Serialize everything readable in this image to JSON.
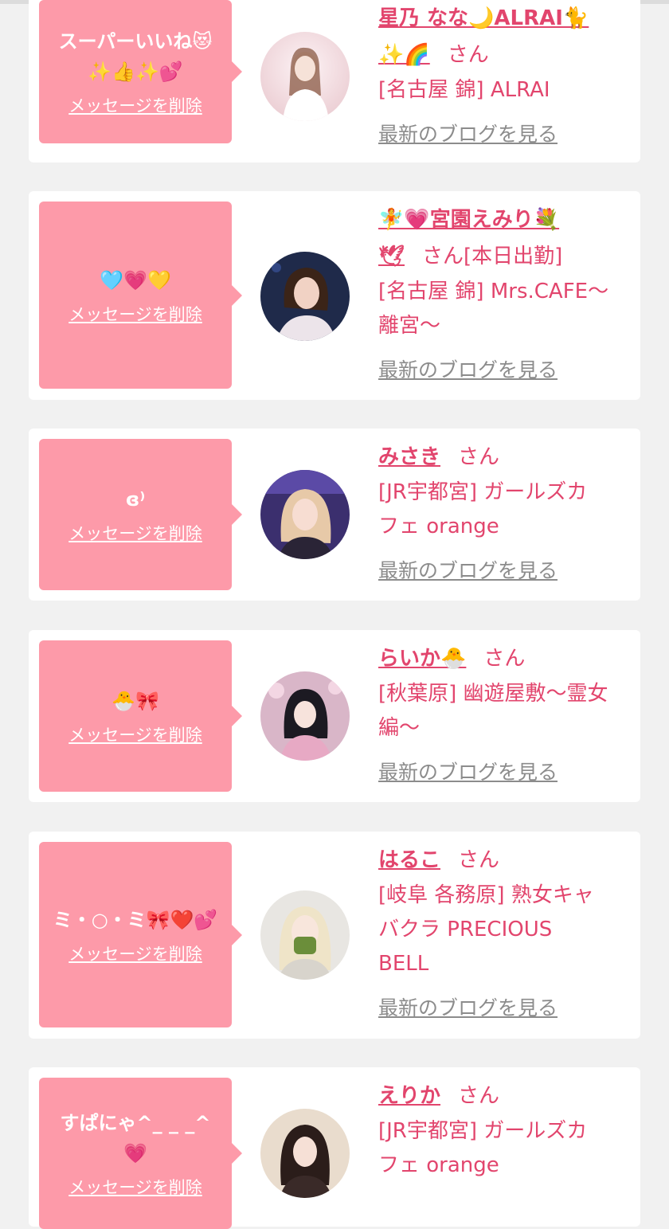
{
  "delete_label": "メッセージを削除",
  "blog_label": "最新のブログを見る",
  "colors": {
    "accent": "#e2456d",
    "bubble": "#fd9aa9",
    "card": "#ffffff",
    "background": "#f1f1f1",
    "link_gray": "#8c8c8c"
  },
  "items": [
    {
      "message": "スーパーいいね😻\n✨👍✨💕",
      "name": "星乃 なな🌙ALRAI🐈\n✨🌈",
      "san": "さん",
      "extra": "",
      "shop": "[名古屋 錦] ALRAI"
    },
    {
      "message": "🩵💗💛",
      "name": "🧚💗宮園えみり💐\n🕊",
      "san": "さん",
      "extra": "[本日出勤]",
      "shop": "[名古屋 錦] Mrs.CAFE〜\n離宮〜"
    },
    {
      "message": "ɞ⁾",
      "name": "みさき",
      "san": "さん",
      "extra": "",
      "shop": "[JR宇都宮] ガールズカ\nフェ orange"
    },
    {
      "message": "🐣🎀",
      "name": "らいか🐣",
      "san": "さん",
      "extra": "",
      "shop": "[秋葉原] 幽遊屋敷〜霊女\n編〜"
    },
    {
      "message": "ミ・○・ミ🎀❤️💕",
      "name": "はるこ",
      "san": "さん",
      "extra": "",
      "shop": "[岐阜 各務原]  熟女キャ\nバクラ PRECIOUS\nBELL"
    },
    {
      "message": "すぱにゃ^_ _ _^\n💗",
      "name": "えりか",
      "san": "さん",
      "extra": "",
      "shop": "[JR宇都宮] ガールズカ\nフェ orange"
    }
  ]
}
